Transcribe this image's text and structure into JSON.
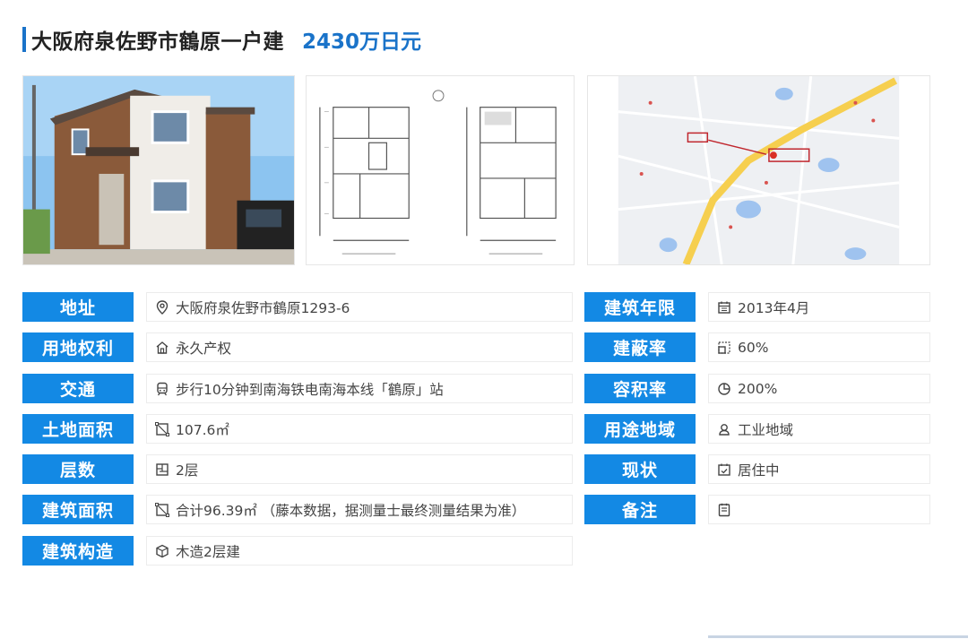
{
  "header": {
    "title": "大阪府泉佐野市鶴原一户建",
    "price": "2430万日元"
  },
  "photos": [
    {
      "name": "house-exterior-photo",
      "kind": "photo"
    },
    {
      "name": "floor-plan-image",
      "kind": "floorplan"
    },
    {
      "name": "location-map-image",
      "kind": "map"
    }
  ],
  "details_left": [
    {
      "label": "地址",
      "icon": "location-pin-icon",
      "value": "大阪府泉佐野市鶴原1293-6"
    },
    {
      "label": "用地权利",
      "icon": "house-icon",
      "value": "永久产权"
    },
    {
      "label": "交通",
      "icon": "train-icon",
      "value": "步行10分钟到南海铁电南海本线「鶴原」站"
    },
    {
      "label": "土地面积",
      "icon": "area-icon",
      "value": "107.6㎡"
    },
    {
      "label": "层数",
      "icon": "floors-icon",
      "value": "2层"
    },
    {
      "label": "建筑面积",
      "icon": "area-icon",
      "value": "合计96.39㎡ （藤本数据，据测量士最终测量结果为准）"
    },
    {
      "label": "建筑构造",
      "icon": "cube-icon",
      "value": "木造2层建"
    }
  ],
  "details_right": [
    {
      "label": "建筑年限",
      "icon": "calendar-icon",
      "value": "2013年4月"
    },
    {
      "label": "建蔽率",
      "icon": "ratio-icon",
      "value": "60%"
    },
    {
      "label": "容积率",
      "icon": "pie-icon",
      "value": "200%"
    },
    {
      "label": "用途地域",
      "icon": "zone-icon",
      "value": "工业地域"
    },
    {
      "label": "现状",
      "icon": "status-icon",
      "value": "居住中"
    },
    {
      "label": "备注",
      "icon": "note-icon",
      "value": ""
    }
  ],
  "colors": {
    "accent": "#1a73c9",
    "label_bg": "#1389e4"
  }
}
